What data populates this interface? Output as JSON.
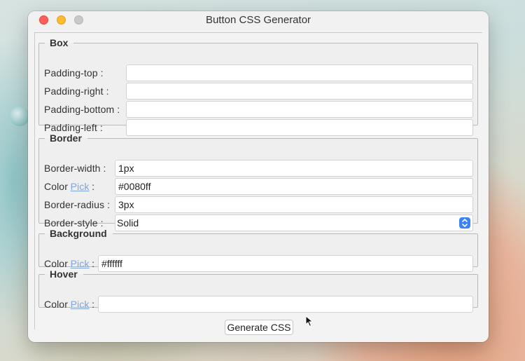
{
  "window": {
    "title": "Button CSS Generator"
  },
  "box": {
    "legend": "Box",
    "fields": [
      {
        "label": "Padding-top :",
        "value": ""
      },
      {
        "label": "Padding-right :",
        "value": ""
      },
      {
        "label": "Padding-bottom :",
        "value": ""
      },
      {
        "label": "Padding-left :",
        "value": ""
      }
    ]
  },
  "border": {
    "legend": "Border",
    "width_label": "Border-width :",
    "width_value": "1px",
    "color_label": "Color",
    "color_pick": "Pick",
    "color_colon": ":",
    "color_value": "#0080ff",
    "radius_label": "Border-radius :",
    "radius_value": "3px",
    "style_label": "Border-style :",
    "style_value": "Solid"
  },
  "background": {
    "legend": "Background",
    "color_label": "Color",
    "color_pick": "Pick",
    "color_colon": ":",
    "color_value": "#ffffff"
  },
  "hover": {
    "legend": "Hover",
    "color_label": "Color",
    "color_pick": "Pick",
    "color_colon": ":",
    "color_value": ""
  },
  "actions": {
    "generate_label": "Generate CSS"
  },
  "colors": {
    "pick_link": "#7ea4dc",
    "select_accent": "#3b82f6",
    "close": "#fe5f57",
    "minimize": "#febc2e",
    "maximize_disabled": "#c8c8c8"
  },
  "icons": [
    "close-icon",
    "minimize-icon",
    "maximize-icon",
    "updown-arrows-icon",
    "mouse-cursor-icon"
  ]
}
